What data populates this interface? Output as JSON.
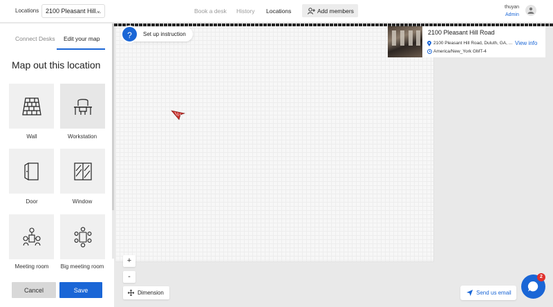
{
  "topbar": {
    "locations_label": "Locations",
    "location_select_value": "2100 Pleasant Hill...",
    "nav": [
      {
        "label": "Book a desk",
        "active": false
      },
      {
        "label": "History",
        "active": false
      },
      {
        "label": "Locations",
        "active": true
      }
    ],
    "add_members_label": "Add members",
    "user_name": "thuyan",
    "user_role": "Admin"
  },
  "sidebar": {
    "tabs": [
      {
        "label": "Connect Desks",
        "active": false
      },
      {
        "label": "Edit your map",
        "active": true
      }
    ],
    "title": "Map out this location",
    "tiles": [
      {
        "label": "Wall",
        "icon": "wall-icon"
      },
      {
        "label": "Workstation",
        "icon": "workstation-icon"
      },
      {
        "label": "Door",
        "icon": "door-icon"
      },
      {
        "label": "Window",
        "icon": "window-icon"
      },
      {
        "label": "Meeting room",
        "icon": "meeting-room-icon"
      },
      {
        "label": "Big meeting room",
        "icon": "big-meeting-room-icon"
      }
    ],
    "cancel_label": "Cancel",
    "save_label": "Save"
  },
  "map": {
    "setup_help_glyph": "?",
    "setup_label": "Set up instruction",
    "location_card": {
      "name": "2100 Pleasant Hill Road",
      "address": "2100 Pleasant Hill Road, Duluth, GA, ...",
      "timezone": "America/New_York GMT-4",
      "view_info_label": "View info"
    },
    "zoom_in_label": "+",
    "zoom_out_label": "-",
    "dimension_label": "Dimension",
    "send_email_label": "Send us email",
    "chat_badge_count": "2"
  },
  "colors": {
    "accent": "#1a66d6",
    "badge": "#e0312d"
  }
}
